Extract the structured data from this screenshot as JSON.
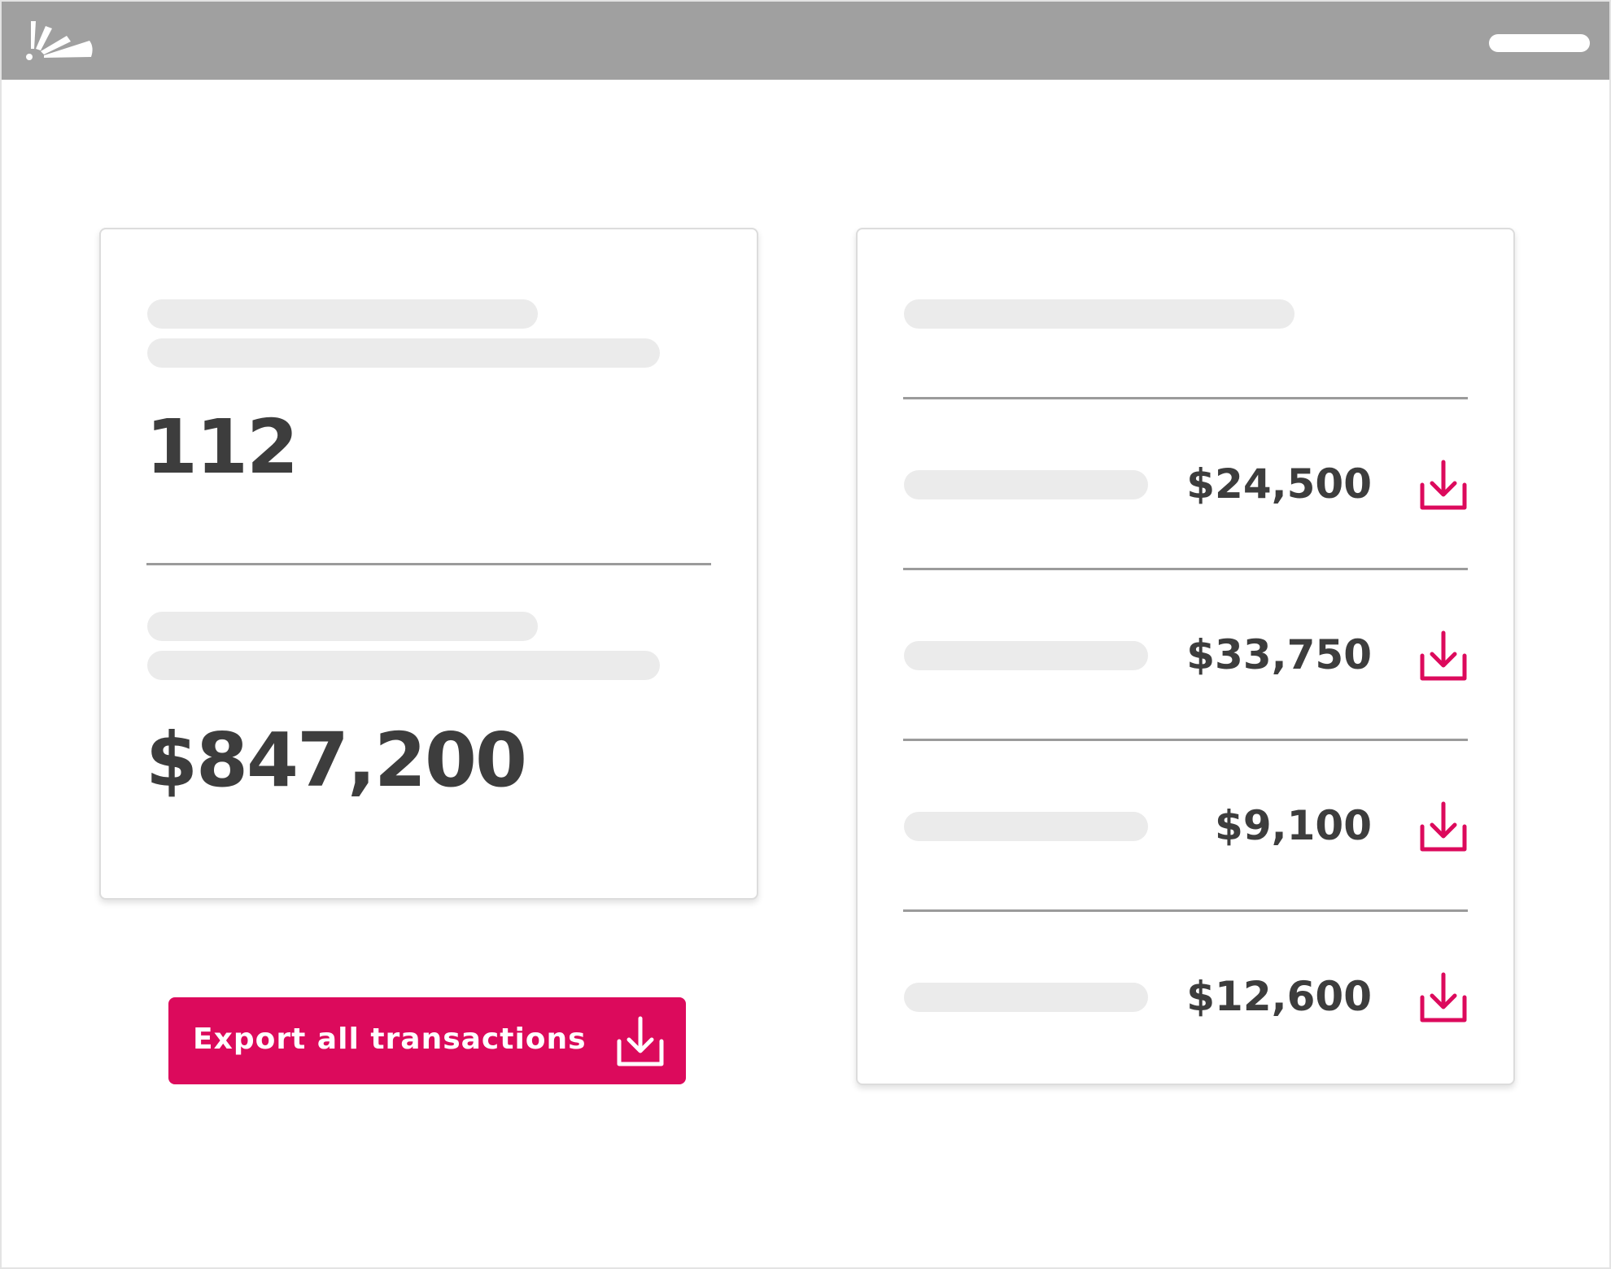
{
  "header": {
    "logo_icon": "sunburst-logo-icon",
    "window_control_icon": "minimize-bar-icon"
  },
  "summary": {
    "count_value": "112",
    "total_value": "$847,200"
  },
  "transactions": {
    "items": [
      {
        "amount": "$24,500",
        "icon": "download-icon"
      },
      {
        "amount": "$33,750",
        "icon": "download-icon"
      },
      {
        "amount": "$9,100",
        "icon": "download-icon"
      },
      {
        "amount": "$12,600",
        "icon": "download-icon"
      }
    ]
  },
  "export": {
    "label": "Export all transactions",
    "icon": "download-icon"
  },
  "colors": {
    "accent": "#dc0a5c",
    "header": "#a0a0a0",
    "skeleton": "#ebebeb",
    "text": "#3d3d3d"
  }
}
